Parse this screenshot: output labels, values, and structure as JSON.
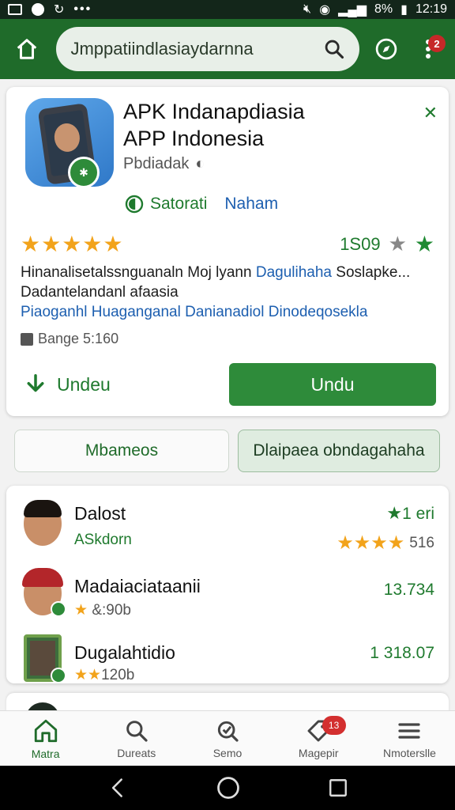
{
  "status_bar": {
    "time": "12:19",
    "battery": "8%"
  },
  "search": {
    "value": "Jmppatiindlasiaydarnna"
  },
  "notification_count": "2",
  "app": {
    "title_line1": "APK Indanapdiasia",
    "title_line2": "APP Indonesia",
    "developer": "Pbdiadak",
    "meta_green": "Satorati",
    "meta_blue": "Naham",
    "stars": "★★★★★",
    "rating_count": "1S09",
    "desc_black1": "Hinanalisetalssnguanaln Moj lyann",
    "desc_blue1": "Dagulihaha",
    "desc_black2": "Soslapke...",
    "desc_line2": "Dadantelandanl afaasia",
    "desc_line3": "Piaoganhl Huaganganal Danianadiol Dinodeqosekla",
    "size": "Bange 5:160",
    "download_link": "Undeu",
    "download_button": "Undu"
  },
  "pills": [
    "Mbameos",
    "Dlaipaea obndagahaha"
  ],
  "list": [
    {
      "name": "Dalost",
      "sub": "ASkdorn",
      "right": "1 eri",
      "right_stars": "★★★★",
      "right_count": "516"
    },
    {
      "name": "Madaiaciataanii",
      "sub_stars": "★",
      "sub": "&:90b",
      "right": "13.734"
    },
    {
      "name": "Dugalahtidio",
      "sub_stars": "★★",
      "sub": "120b",
      "right": "1 318.07"
    }
  ],
  "nav": [
    {
      "label": "Matra",
      "icon": "home-icon"
    },
    {
      "label": "Dureats",
      "icon": "search-icon"
    },
    {
      "label": "Semo",
      "icon": "explore-icon"
    },
    {
      "label": "Magepir",
      "icon": "tag-icon",
      "badge": "13"
    },
    {
      "label": "Nmoterslle",
      "icon": "menu-icon"
    }
  ],
  "colors": {
    "brand_green": "#1f6b2a",
    "button_green": "#2e8b3a",
    "star": "#f2a31b",
    "link_blue": "#1d5fb0"
  }
}
